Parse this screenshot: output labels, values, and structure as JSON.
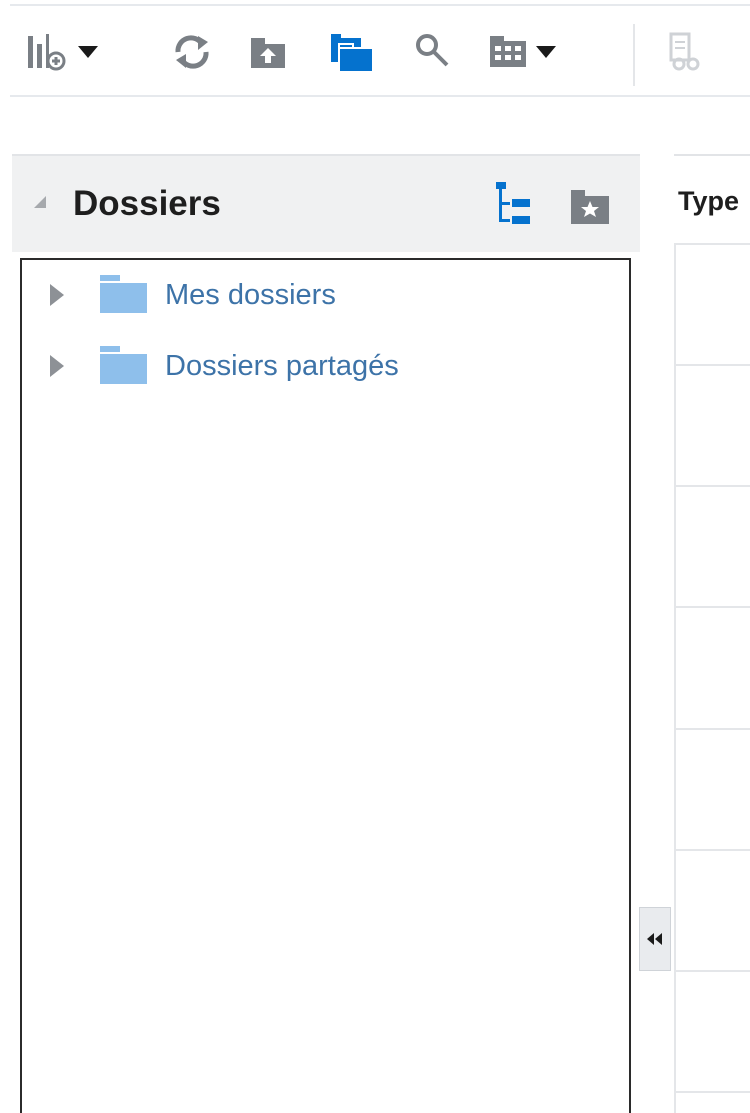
{
  "toolbar": {
    "items": [
      {
        "name": "columns-add-icon",
        "has_dropdown": true
      },
      {
        "name": "refresh-icon"
      },
      {
        "name": "folder-upload-icon"
      },
      {
        "name": "folders-icon"
      },
      {
        "name": "search-icon"
      },
      {
        "name": "grid-view-icon",
        "has_dropdown": true
      },
      {
        "name": "properties-icon",
        "disabled": true
      }
    ]
  },
  "folders_panel": {
    "title": "Dossiers",
    "header_icons": [
      "tree-view-icon",
      "favorite-folder-icon"
    ],
    "tree": [
      {
        "label": "Mes dossiers",
        "expanded": false,
        "icon": "folder-icon"
      },
      {
        "label": "Dossiers partagés",
        "expanded": false,
        "icon": "folder-icon"
      }
    ]
  },
  "content_panel": {
    "column_header": "Type"
  },
  "splitter": {
    "icon": "double-chevron-left-icon"
  },
  "colors": {
    "accent_blue": "#0572ce",
    "folder_blue": "#8ebfeb",
    "link_text": "#3d73a8",
    "icon_gray": "#7a7f85"
  }
}
